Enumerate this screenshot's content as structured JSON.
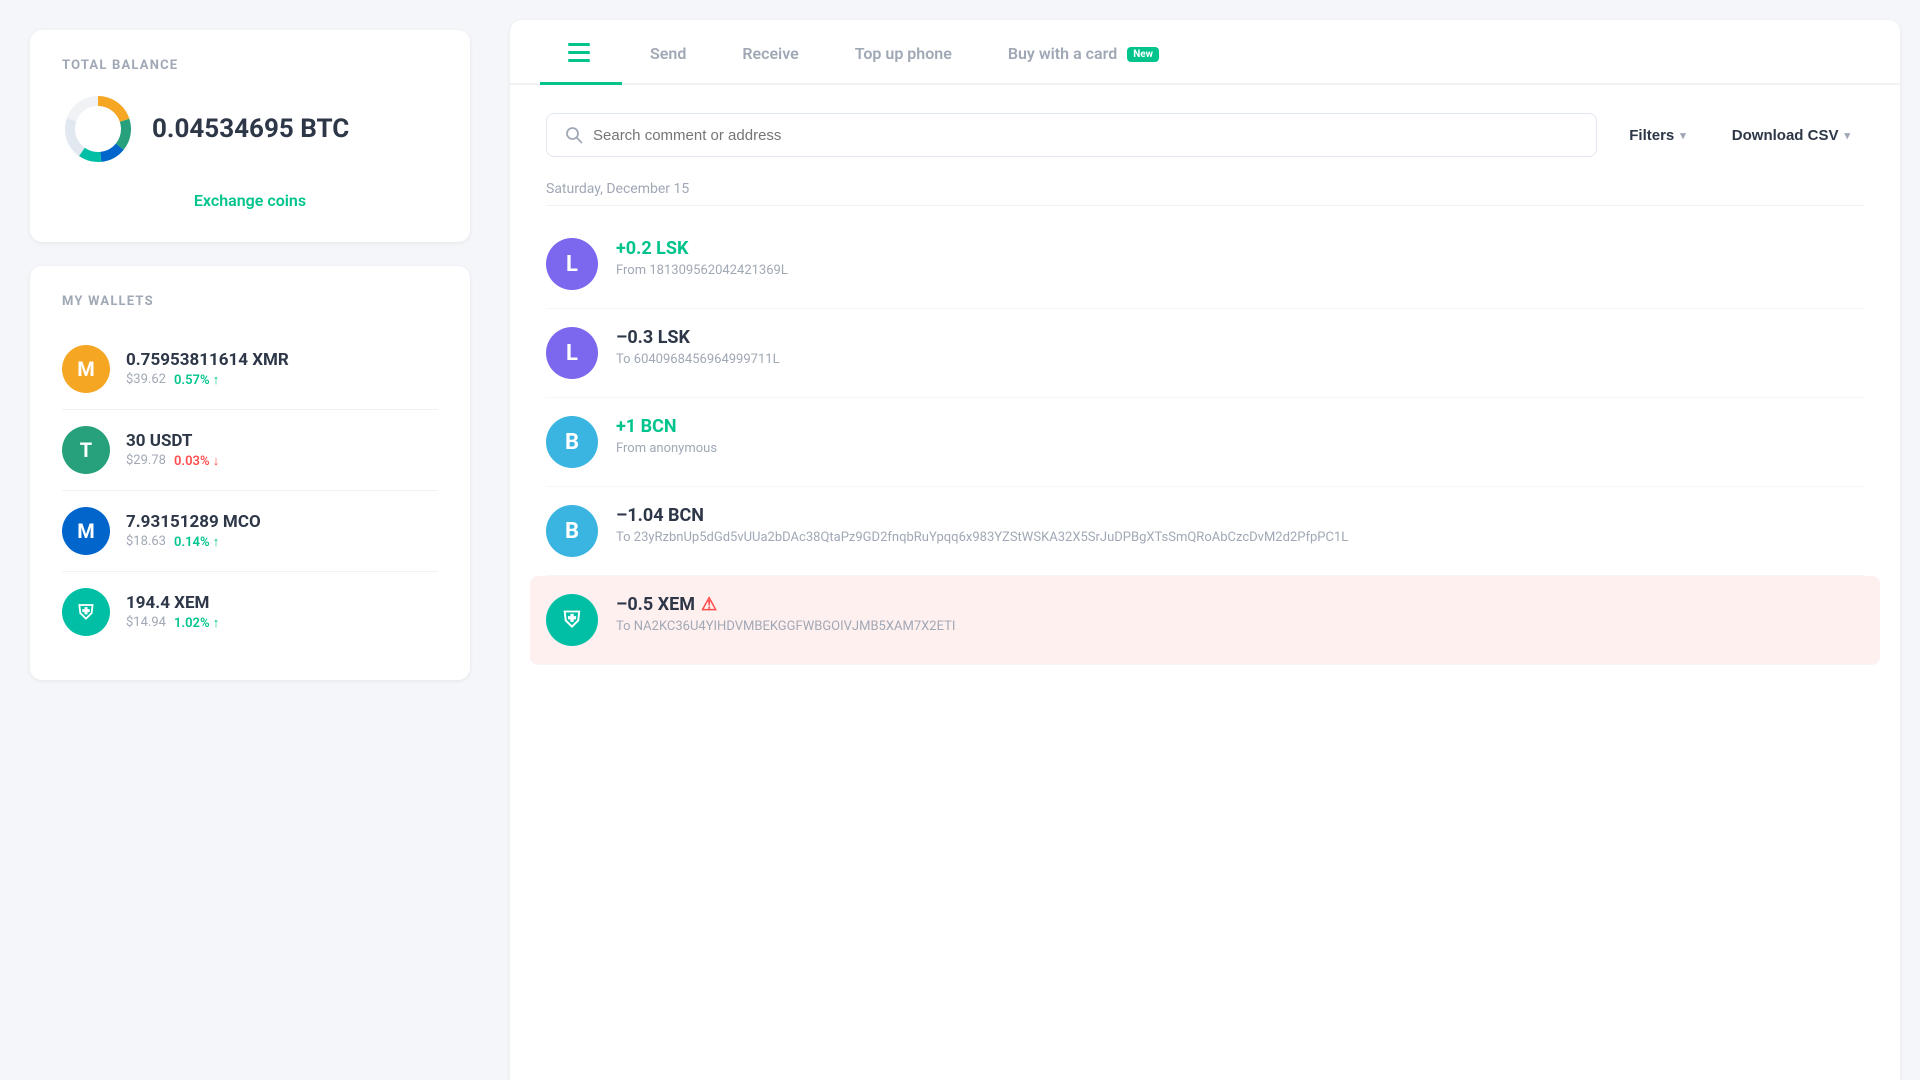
{
  "left": {
    "total_balance": {
      "title": "TOTAL BALANCE",
      "amount": "0.04534695 BTC",
      "exchange_label": "Exchange coins"
    },
    "my_wallets": {
      "title": "MY WALLETS",
      "items": [
        {
          "symbol": "M",
          "bg": "#f5a623",
          "amount": "0.75953811614 XMR",
          "usd": "$39.62",
          "pct": "0.57% ↑",
          "pct_type": "up"
        },
        {
          "symbol": "T",
          "bg": "#26a17b",
          "amount": "30 USDT",
          "usd": "$29.78",
          "pct": "0.03% ↓",
          "pct_type": "down"
        },
        {
          "symbol": "M",
          "bg": "#0066cc",
          "amount": "7.93151289 MCO",
          "usd": "$18.63",
          "pct": "0.14% ↑",
          "pct_type": "up"
        },
        {
          "symbol": "⛨",
          "bg": "#00bfa5",
          "amount": "194.4 XEM",
          "usd": "$14.94",
          "pct": "1.02% ↑",
          "pct_type": "up"
        }
      ]
    }
  },
  "right": {
    "tabs": [
      {
        "id": "history",
        "label": "",
        "icon": "list",
        "active": true
      },
      {
        "id": "send",
        "label": "Send",
        "active": false
      },
      {
        "id": "receive",
        "label": "Receive",
        "active": false
      },
      {
        "id": "topup",
        "label": "Top up phone",
        "active": false
      },
      {
        "id": "buywithcard",
        "label": "Buy with a card",
        "badge": "New",
        "active": false
      }
    ],
    "search": {
      "placeholder": "Search comment or address"
    },
    "filters_label": "Filters",
    "csv_label": "Download CSV",
    "date_section": "Saturday, December 15",
    "transactions": [
      {
        "id": "tx1",
        "avatar_letter": "L",
        "avatar_bg": "#7b68ee",
        "amount": "+0.2 LSK",
        "amount_type": "positive",
        "from_label": "From 18130956204242136 9L",
        "from": "From 181309562042421369L",
        "highlighted": false
      },
      {
        "id": "tx2",
        "avatar_letter": "L",
        "avatar_bg": "#7b68ee",
        "amount": "–0.3 LSK",
        "amount_type": "negative",
        "from": "To 6040968456964999711L",
        "highlighted": false
      },
      {
        "id": "tx3",
        "avatar_letter": "B",
        "avatar_bg": "#3ab4e0",
        "amount": "+1 BCN",
        "amount_type": "positive",
        "from": "From anonymous",
        "highlighted": false
      },
      {
        "id": "tx4",
        "avatar_letter": "B",
        "avatar_bg": "#3ab4e0",
        "amount": "–1.04 BCN",
        "amount_type": "negative",
        "from": "To 23yRzbnUp5dGd5vUUa2bDAc38QtaPz9GD2fnqbRuYpqq6x983YZStWSKA32X5SrJuDPBgXTsSmQRoAbCzcDvM2d2PfpPC1L",
        "highlighted": false
      },
      {
        "id": "tx5",
        "avatar_letter": "⛨",
        "avatar_bg": "#00bfa5",
        "amount": "–0.5 XEM",
        "amount_type": "negative",
        "from": "To NA2KC36U4YIHDVMBEKGGFWBGOIVJMB5XAM7X2ETI",
        "highlighted": true,
        "warning": true
      }
    ]
  }
}
